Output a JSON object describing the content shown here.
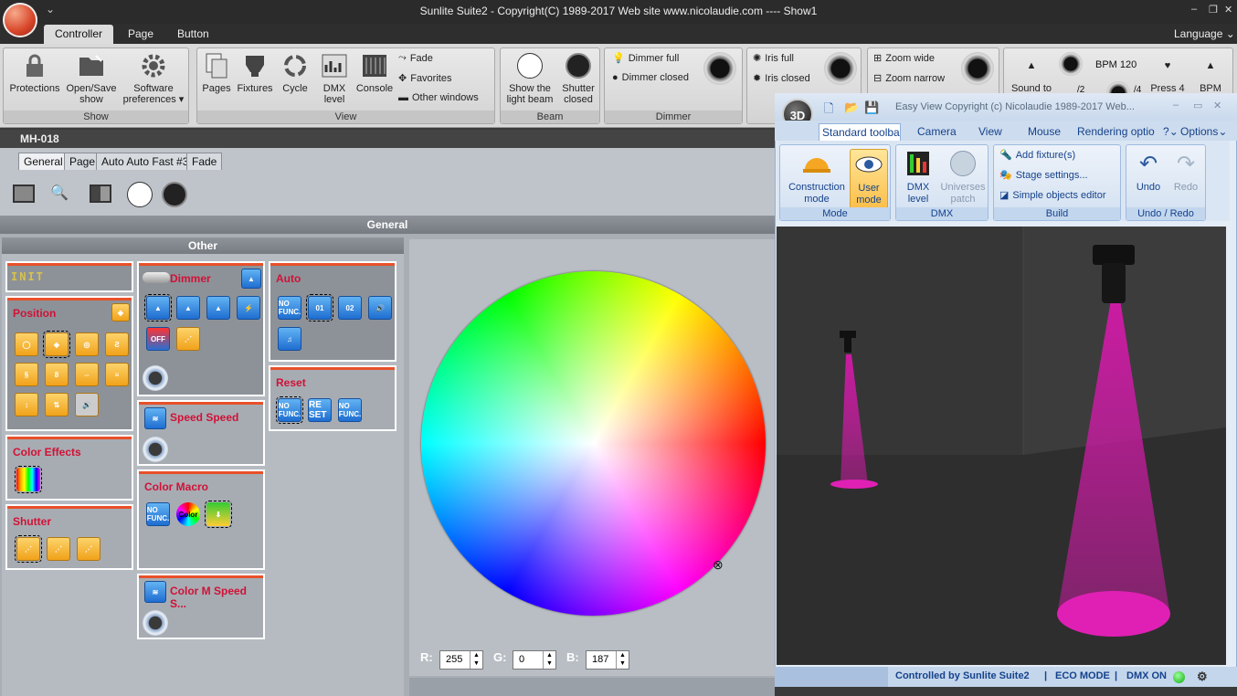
{
  "window": {
    "title": "Sunlite Suite2 - Copyright(C) 1989-2017    Web site www.nicolaudie.com ---- Show1"
  },
  "menu": {
    "tabs": [
      "Controller",
      "Page",
      "Button"
    ],
    "language": "Language"
  },
  "ribbon": {
    "show": {
      "label": "Show",
      "protections": "Protections",
      "open_save": "Open/Save show",
      "software": "Software preferences"
    },
    "view": {
      "label": "View",
      "pages": "Pages",
      "fixtures": "Fixtures",
      "cycle": "Cycle",
      "dmx": "DMX level",
      "console": "Console",
      "fade": "Fade",
      "favorites": "Favorites",
      "other": "Other windows"
    },
    "beam": {
      "label": "Beam",
      "show_beam": "Show the light beam",
      "shutter_closed": "Shutter closed"
    },
    "dimmer": {
      "label": "Dimmer",
      "full": "Dimmer full",
      "closed": "Dimmer closed"
    },
    "iris": {
      "full": "Iris full",
      "closed": "Iris closed"
    },
    "zoom": {
      "wide": "Zoom wide",
      "narrow": "Zoom narrow"
    },
    "bpm": {
      "sound": "Sound to",
      "bpm120": "BPM 120",
      "press": "Press 4",
      "bpm": "BPM",
      "div2": "/2",
      "div4": "/4"
    }
  },
  "fixture": {
    "name": "MH-018",
    "tabs": [
      "General",
      "Page",
      "Auto Auto Fast #3",
      "Fade"
    ],
    "general": "General",
    "other": "Other"
  },
  "panels": {
    "init": "INIT",
    "position": "Position",
    "color_effects": "Color Effects",
    "shutter": "Shutter",
    "dimmer": "Dimmer",
    "speed": "Speed Speed",
    "color_macro": "Color Macro",
    "color_m_speed": "Color M Speed S...",
    "auto": "Auto",
    "reset": "Reset"
  },
  "icons": {
    "nofunc": "NO FUNC.",
    "reset": "RE SET",
    "color": "Color",
    "off": "OFF",
    "n01": "01",
    "n02": "02"
  },
  "rgb": {
    "r_label": "R:",
    "r": "255",
    "g_label": "G:",
    "g": "0",
    "b_label": "B:",
    "b": "187"
  },
  "easyview": {
    "title": "Easy View   Copyright (c) Nicolaudie 1989-2017    Web...",
    "tabs": [
      "Standard toolbar",
      "Camera",
      "View",
      "Mouse",
      "Rendering optio"
    ],
    "help": "?",
    "options": "Options",
    "mode": {
      "label": "Mode",
      "construction": "Construction mode",
      "user": "User mode"
    },
    "dmx": {
      "label": "DMX",
      "level": "DMX level",
      "universes": "Universes patch"
    },
    "build": {
      "label": "Build",
      "add": "Add fixture(s)",
      "stage": "Stage settings...",
      "simple": "Simple objects editor"
    },
    "undo": {
      "label": "Undo / Redo",
      "undo": "Undo",
      "redo": "Redo"
    },
    "status": {
      "controlled": "Controlled by Sunlite Suite2",
      "eco": "ECO MODE",
      "dmx": "DMX ON"
    }
  },
  "colors": {
    "accent": "#e8502a",
    "panel_title": "#d01236",
    "beam": "#d21aa8"
  }
}
